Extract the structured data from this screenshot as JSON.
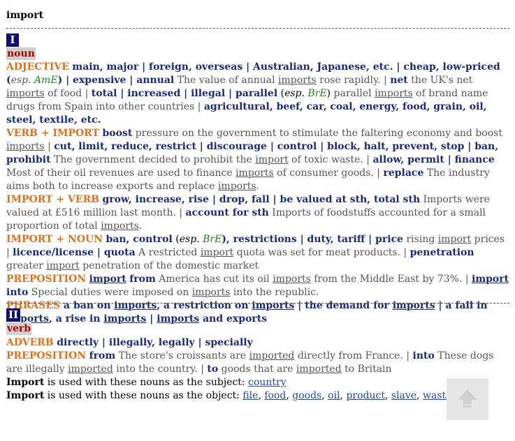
{
  "headword": "import",
  "sense_I": {
    "number": "I",
    "pos": "noun",
    "adj_label": "ADJECTIVE",
    "adj_1": "main, major | foreign, overseas | Australian, Japanese, etc. | cheap, low-priced (",
    "adj_esp": "esp.",
    "adj_ame": "AmE",
    "adj_2": ") | expensive | annual",
    "adj_ex1a": " The value of annual ",
    "adj_imports": "imports",
    "adj_ex1b": " rose rapidly. | ",
    "adj_net": "net",
    "adj_ex2a": " the UK's net ",
    "adj_ex2b": " of food | ",
    "adj_3": "total | increased | illegal | parallel",
    "adj_bre_open": " (",
    "adj_bre": "BrE",
    "adj_bre_close": ")",
    "adj_ex3a": " parallel ",
    "adj_ex3b": " of brand name drugs from Spain into other countries | ",
    "adj_4": "agricultural, beef, car, coal, energy, food, grain, oil, steel, textile, etc.",
    "vi_label": "VERB + IMPORT",
    "vi_boost": "boost",
    "vi_ex1a": " pressure on the government to stimulate the faltering economy and boost ",
    "vi_ex1b": " | ",
    "vi_2": "cut, limit, reduce, restrict | discourage | control | block, halt, prevent, stop | ban, prohibit",
    "vi_ex2a": " The government decided to prohibit the ",
    "vi_import": "import",
    "vi_ex2b": " of toxic waste. | ",
    "vi_3": "allow, permit | finance",
    "vi_ex3a": " Most of their oil revenues are used to finance ",
    "vi_ex3b": " of consumer goods. | ",
    "vi_4": "replace",
    "vi_ex4a": " The industry aims both to increase exports and replace ",
    "vi_ex4b": ".",
    "iv_label": "IMPORT + VERB",
    "iv_1": "grow, increase, rise | drop, fall | be valued at sth, total sth",
    "iv_ex1": " Imports were valued at £516 million last month. | ",
    "iv_2": "account for sth",
    "iv_ex2a": " Imports of foodstuffs accounted for a small proportion of total ",
    "iv_ex2b": ".",
    "in_label": "IMPORT + NOUN",
    "in_1": "ban, control",
    "in_1b": "), restrictions | duty, tariff | price",
    "in_ex1a": " rising ",
    "in_ex1b": " prices | ",
    "in_2": "licence/license | quota",
    "in_ex2a": " A restricted ",
    "in_ex2b": " quota was set for meat products. | ",
    "in_3": "penetration",
    "in_ex3a": " greater ",
    "in_ex3b": " penetration of the domestic market",
    "prep_label": "PREPOSITION",
    "prep_import": "import",
    "prep_from": "from",
    "prep_ex1a": " America has cut its oil ",
    "prep_ex1b": " from the Middle East by 73%. | ",
    "prep_into": "into",
    "prep_ex2a": " Special duties were imposed on ",
    "prep_ex2b": " into the republic.",
    "phr_label": "PHRASES",
    "phr_1": "a ban on",
    "phr_2": ", a restriction on",
    "phr_3": " | the demand for",
    "phr_4": " | a fall in",
    "phr_5": ", a rise in",
    "phr_6": " | ",
    "phr_7": " and exports"
  },
  "sense_II": {
    "number": "II",
    "pos": "verb",
    "adv_label": "ADVERB",
    "adv_1": "directly | illegally, legally | specially",
    "prep_label": "PREPOSITION",
    "prep_from": "from",
    "prep_ex1a": " The store's croissants are ",
    "prep_imported": "imported",
    "prep_ex1b": " directly from France. | ",
    "prep_into": "into",
    "prep_ex2a": " These dogs are illegally ",
    "prep_ex2b": " into the country. | ",
    "prep_to": "to",
    "prep_ex3a": " goods that are ",
    "prep_ex3b": " to Britain",
    "subject_word": "Import",
    "subject_text": " is used with these nouns as the subject: ",
    "subject_nouns": [
      "country"
    ],
    "object_word": "Import",
    "object_text": " is used with these nouns as the object: ",
    "object_nouns": [
      "file",
      "food",
      "goods",
      "oil",
      "product",
      "slave",
      "waste"
    ]
  },
  "icons": {
    "back_to_top": "arrow-up-icon"
  },
  "colors": {
    "label": "#e0701c",
    "collocate": "#1a2a7a",
    "pos": "#b00000",
    "link": "#1a4aa8",
    "numbox": "#0d0d75"
  }
}
